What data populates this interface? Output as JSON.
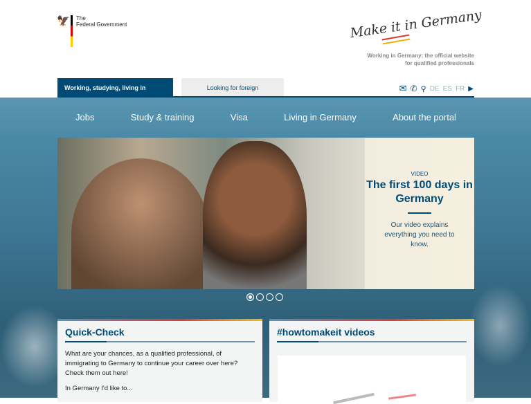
{
  "header": {
    "gov_line1": "The",
    "gov_line2": "Federal Government",
    "logo_text": "Make it in Germany",
    "tagline_line1": "Working in Germany: the official website",
    "tagline_line2": "for qualified professionals"
  },
  "tabs": [
    {
      "label": "Working, studying, living in Germany",
      "active": true
    },
    {
      "label": "Looking for foreign professionals",
      "active": false
    }
  ],
  "utils": {
    "languages": [
      "DE",
      "ES",
      "FR"
    ]
  },
  "nav": [
    "Jobs",
    "Study & training",
    "Visa",
    "Living in Germany",
    "About the portal"
  ],
  "hero": {
    "kicker": "VIDEO",
    "title": "The first 100 days in Germany",
    "text": "Our video explains everything you need to know.",
    "slides": 4,
    "active_slide": 1
  },
  "cards": [
    {
      "title": "Quick-Check",
      "text": "What are your chances, as a qualified professional, of immigrating to Germany to continue your career over here? Check them out here!",
      "text2": "In Germany I'd like to..."
    },
    {
      "title": "#howtomakeit videos"
    }
  ]
}
